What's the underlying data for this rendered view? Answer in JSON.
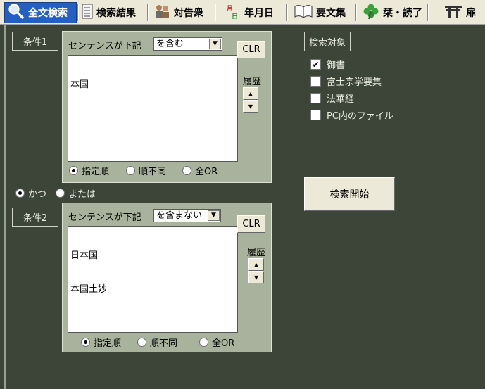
{
  "tabs": [
    {
      "label": "全文検索",
      "icon": "magnifier-icon"
    },
    {
      "label": "検索結果",
      "icon": "document-list-icon"
    },
    {
      "label": "対告衆",
      "icon": "people-icon"
    },
    {
      "label": "年月日",
      "icon": "calendar-icon"
    },
    {
      "label": "要文集",
      "icon": "open-book-icon"
    },
    {
      "label": "栞・読了",
      "icon": "clover-icon"
    },
    {
      "label": "扉",
      "icon": "torii-icon"
    }
  ],
  "condition1": {
    "label": "条件1",
    "sentence_label": "センテンスが下記",
    "mode": "を含む",
    "text_lines": [
      "本国"
    ],
    "clr": "CLR",
    "history": "履歴",
    "order_options": [
      "指定順",
      "順不同",
      "全OR"
    ],
    "order_selected": 0
  },
  "logic": {
    "options": [
      "かつ",
      "または"
    ],
    "selected": 0
  },
  "condition2": {
    "label": "条件2",
    "sentence_label": "センテンスが下記",
    "mode": "を含まない",
    "text_lines": [
      "日本国",
      "本国土妙"
    ],
    "clr": "CLR",
    "history": "履歴",
    "order_options": [
      "指定順",
      "順不同",
      "全OR"
    ],
    "order_selected": 0
  },
  "targets": {
    "title": "検索対象",
    "items": [
      {
        "label": "御書",
        "checked": true
      },
      {
        "label": "富士宗学要集",
        "checked": false
      },
      {
        "label": "法華経",
        "checked": false
      },
      {
        "label": "PC内のファイル",
        "checked": false
      }
    ]
  },
  "search_button": "検索開始"
}
